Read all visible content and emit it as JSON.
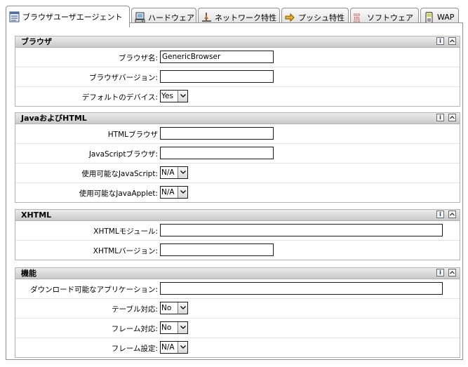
{
  "tabs": [
    {
      "label": "ブラウザユーザエージェント",
      "icon": "browser-page-icon"
    },
    {
      "label": "ハードウェア",
      "icon": "hardware-icon"
    },
    {
      "label": "ネットワーク特性",
      "icon": "network-icon"
    },
    {
      "label": "プッシュ特性",
      "icon": "push-icon"
    },
    {
      "label": "ソフトウェア",
      "icon": "software-icon"
    },
    {
      "label": "WAP",
      "icon": "wap-phone-icon"
    }
  ],
  "sections": {
    "browser": {
      "title": "ブラウザ",
      "rows": [
        {
          "label": "ブラウザ名:",
          "value": "GenericBrowser"
        },
        {
          "label": "ブラウザバージョン:",
          "value": ""
        },
        {
          "label": "デフォルトのデバイス:",
          "value": "Yes"
        }
      ]
    },
    "java_html": {
      "title": "JavaおよびHTML",
      "rows": [
        {
          "label": "HTMLブラウザ",
          "value": ""
        },
        {
          "label": "JavaScriptブラウザ:",
          "value": ""
        },
        {
          "label": "使用可能なJavaScript:",
          "value": "N/A"
        },
        {
          "label": "使用可能なJavaApplet:",
          "value": "N/A"
        }
      ]
    },
    "xhtml": {
      "title": "XHTML",
      "rows": [
        {
          "label": "XHTMLモジュール:",
          "value": ""
        },
        {
          "label": "XHTMLバージョン:",
          "value": ""
        }
      ]
    },
    "features": {
      "title": "機能",
      "rows": [
        {
          "label": "ダウンロード可能なアプリケーション:",
          "value": ""
        },
        {
          "label": "テーブル対応:",
          "value": "No"
        },
        {
          "label": "フレーム対応:",
          "value": "No"
        },
        {
          "label": "フレーム設定:",
          "value": "N/A"
        }
      ]
    }
  },
  "header_buttons": {
    "info": "i",
    "collapse": "^"
  }
}
